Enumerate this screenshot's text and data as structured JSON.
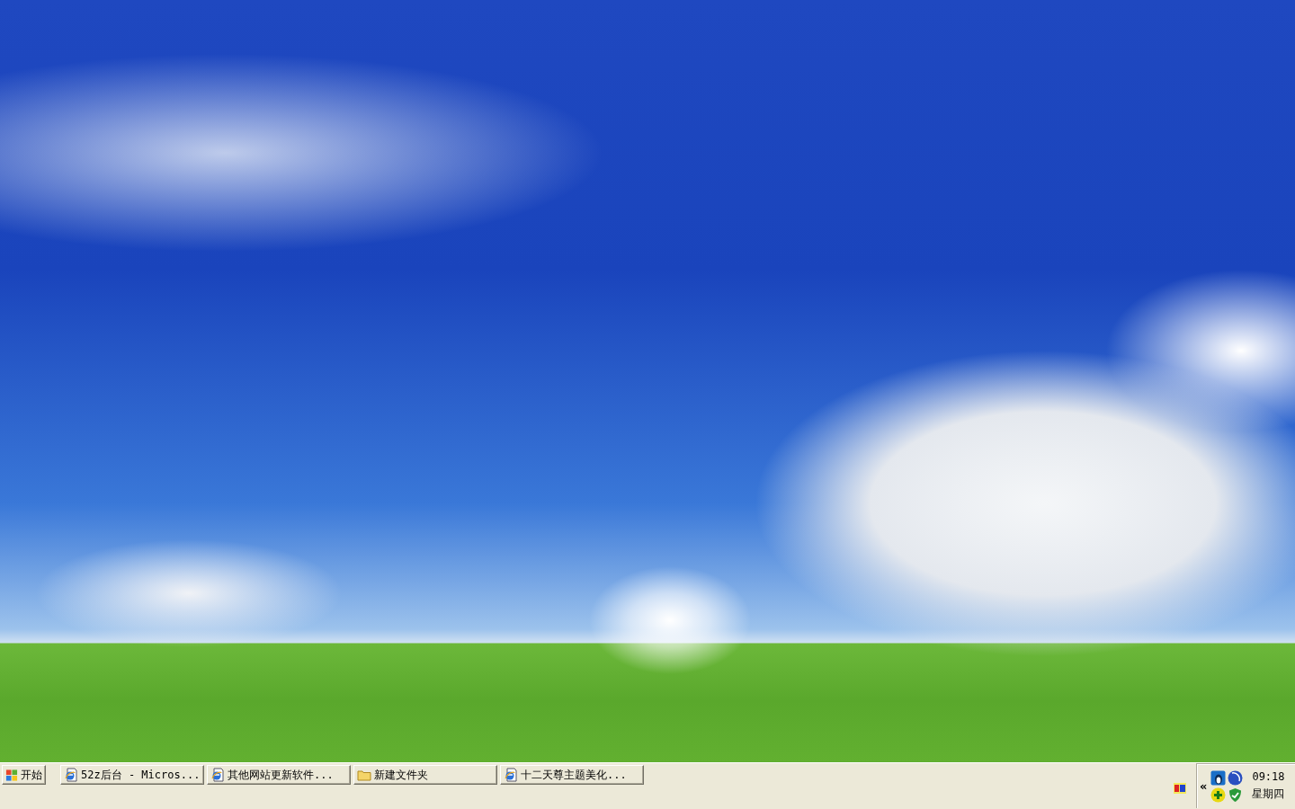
{
  "taskbar": {
    "start_label": "开始",
    "tasks": [
      {
        "label": "52z后台 - Micros...",
        "kind": "browser",
        "selected": false
      },
      {
        "label": "其他网站更新软件...",
        "kind": "browser",
        "selected": false
      },
      {
        "label": "新建文件夹",
        "kind": "folder",
        "selected": false
      },
      {
        "label": "十二天尊主题美化...",
        "kind": "browser",
        "selected": false
      }
    ],
    "tray_expand": "«",
    "clock": {
      "time": "09:18",
      "day": "星期四"
    }
  }
}
